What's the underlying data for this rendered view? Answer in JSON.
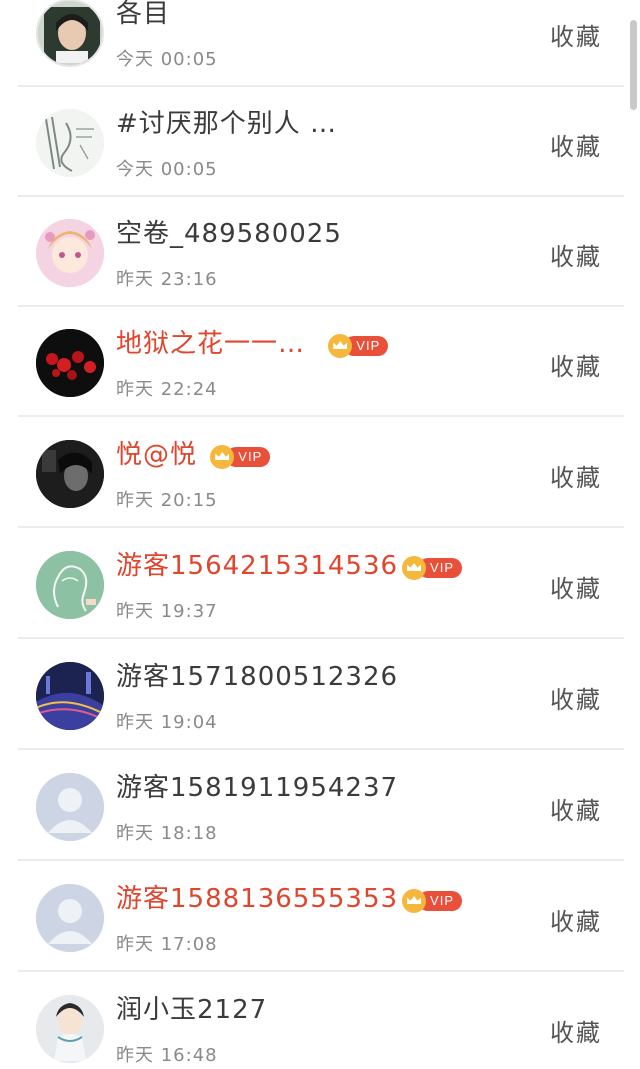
{
  "favorite_label": "收藏",
  "vip_label": "VIP",
  "colors": {
    "vip_name": "#e0452d",
    "vip_badge": "#e9503a",
    "crown": "#f6b83c",
    "divider": "#ececec"
  },
  "rows": [
    {
      "name": "各目",
      "time": "今天 00:05",
      "vip": false,
      "avatar": "girl-photo"
    },
    {
      "name": "#讨厌那个别人 …",
      "time": "今天 00:05",
      "vip": false,
      "avatar": "sketch"
    },
    {
      "name": "空卷_489580025",
      "time": "昨天 23:16",
      "vip": false,
      "avatar": "anime-girl"
    },
    {
      "name": "地狱之花一一…",
      "time": "昨天 22:24",
      "vip": true,
      "avatar": "red-flowers"
    },
    {
      "name": "悦@悦",
      "time": "昨天 20:15",
      "vip": true,
      "avatar": "dark-portrait"
    },
    {
      "name": "游客1564215314536",
      "time": "昨天 19:37",
      "vip": true,
      "avatar": "chalkboard"
    },
    {
      "name": "游客1571800512326",
      "time": "昨天 19:04",
      "vip": false,
      "avatar": "city-night"
    },
    {
      "name": "游客1581911954237",
      "time": "昨天 18:18",
      "vip": false,
      "avatar": "default"
    },
    {
      "name": "游客1588136555353",
      "time": "昨天 17:08",
      "vip": true,
      "avatar": "default"
    },
    {
      "name": "润小玉2127",
      "time": "昨天 16:48",
      "vip": false,
      "avatar": "chibi"
    }
  ]
}
